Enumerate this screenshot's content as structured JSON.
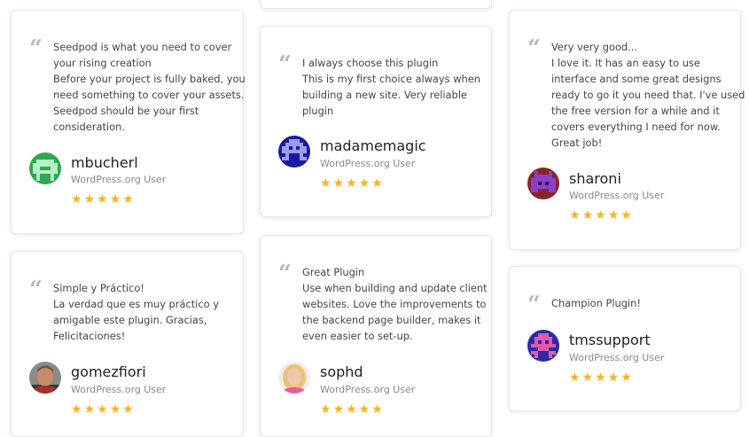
{
  "colors": {
    "star": "#f5b422",
    "quote_icon": "#b9b9b9",
    "text": "#444444",
    "muted": "#888888"
  },
  "quote_icon_glyph": "“",
  "star_glyph": "★",
  "rating": 5,
  "testimonials": [
    {
      "lines": [
        "Seedpod is what you need to cover",
        "your rising creation",
        "Before your project is fully baked, you",
        "need something to cover your assets.",
        "Seedpod should be your first",
        "consideration."
      ],
      "user": "mbucherl",
      "role": "WordPress.org User",
      "avatar": "green-pixel-invader-avatar"
    },
    {
      "lines": [
        "I always choose this plugin",
        "This is my first choice always when",
        "building a new site. Very reliable",
        "plugin"
      ],
      "user": "madamemagic",
      "role": "WordPress.org User",
      "avatar": "blue-pixel-invader-avatar"
    },
    {
      "lines": [
        "Very very good...",
        "I love it. It has an easy to use",
        "interface and some great designs",
        "ready to go it you need that. I've used",
        "the free version for a while and it",
        "covers everything I need for now.",
        "Great job!"
      ],
      "user": "sharoni",
      "role": "WordPress.org User",
      "avatar": "purple-pixel-invader-avatar"
    },
    {
      "lines": [
        "Simple y Práctico!",
        "La verdad que es muy práctico y",
        "amigable este plugin. Gracias,",
        "Felicitaciones!"
      ],
      "user": "gomezfiori",
      "role": "WordPress.org User",
      "avatar": "photo-avatar-man"
    },
    {
      "lines": [
        "Great Plugin",
        "Use when building and update client",
        "websites. Love the improvements to",
        "the backend page builder, makes it",
        "even easier to set-up."
      ],
      "user": "sophd",
      "role": "WordPress.org User",
      "avatar": "photo-avatar-woman"
    },
    {
      "lines": [
        "Champion Plugin!"
      ],
      "user": "tmssupport",
      "role": "WordPress.org User",
      "avatar": "pink-pixel-invader-avatar"
    }
  ]
}
